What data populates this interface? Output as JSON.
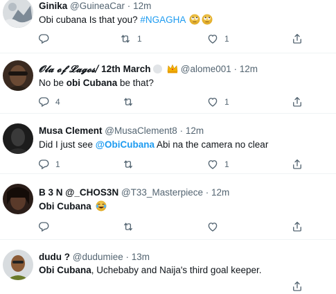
{
  "tweets": [
    {
      "name": "Ginika",
      "handle": "@GuineaCar",
      "separator": "·",
      "time": "12m",
      "text_pre": "Obi cubana Is that you? ",
      "hashtag": "#NGAGHA",
      "emoji_name": "face-with-rolling-eyes",
      "emoji_count": "2",
      "replies": "",
      "retweets": "1",
      "likes": "1"
    },
    {
      "name": "𝓞𝓵𝓪 𝓸𝓯 𝓛𝓪𝓰𝓸𝓼/",
      "date_suffix": " 12th March",
      "badge_names": [
        "white-circle",
        "crown-emoji"
      ],
      "handle": "@alome001",
      "separator": "·",
      "time": "12m",
      "text_pre": "No be ",
      "text_bold": "obi Cubana",
      "text_post": " be that?",
      "replies": "4",
      "retweets": "",
      "likes": "1"
    },
    {
      "name": "Musa Clement",
      "handle": "@MusaClement8",
      "separator": "·",
      "time": "12m",
      "text_pre": "Did I just see ",
      "mention": "@ObiCubana",
      "text_post": " Abi na the camera no clear",
      "replies": "1",
      "retweets": "",
      "likes": "1"
    },
    {
      "name": "B 3 N @_CHOS3N",
      "handle": "@T33_Masterpiece",
      "separator": "·",
      "time": "12m",
      "text_pre": "Obi Cubana ",
      "emoji_name": "face-with-tears-of-joy",
      "replies": "",
      "retweets": "",
      "likes": ""
    },
    {
      "name": "dudu ?",
      "handle": "@dudumiee",
      "separator": "·",
      "time": "13m",
      "text_bold": "Obi Cubana",
      "text_post": ", Uchebaby and Naija's third goal keeper.",
      "replies": "",
      "retweets": "",
      "likes": ""
    }
  ],
  "colors": {
    "text": "#0f1419",
    "secondary": "#536471",
    "link": "#1d9bf0",
    "divider": "#eff3f4"
  },
  "icons": [
    "reply-icon",
    "retweet-icon",
    "like-icon",
    "share-icon"
  ]
}
